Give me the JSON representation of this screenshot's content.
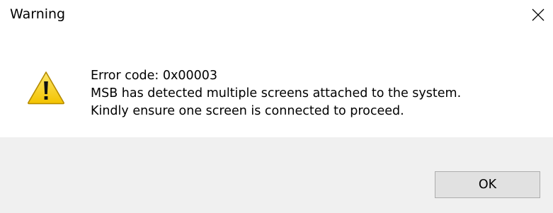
{
  "window": {
    "title": "Warning",
    "close_icon": "close-icon"
  },
  "message": {
    "icon": "warning-icon",
    "lines": [
      "Error code: 0x00003",
      "MSB has detected multiple screens attached to the system.",
      "Kindly ensure one screen is connected to proceed."
    ]
  },
  "buttons": {
    "ok_label": "OK"
  },
  "colors": {
    "footer_background": "#f0f0f0",
    "button_background": "#e1e1e1",
    "button_border": "#adadad",
    "warning_yellow": "#f8d21c"
  }
}
